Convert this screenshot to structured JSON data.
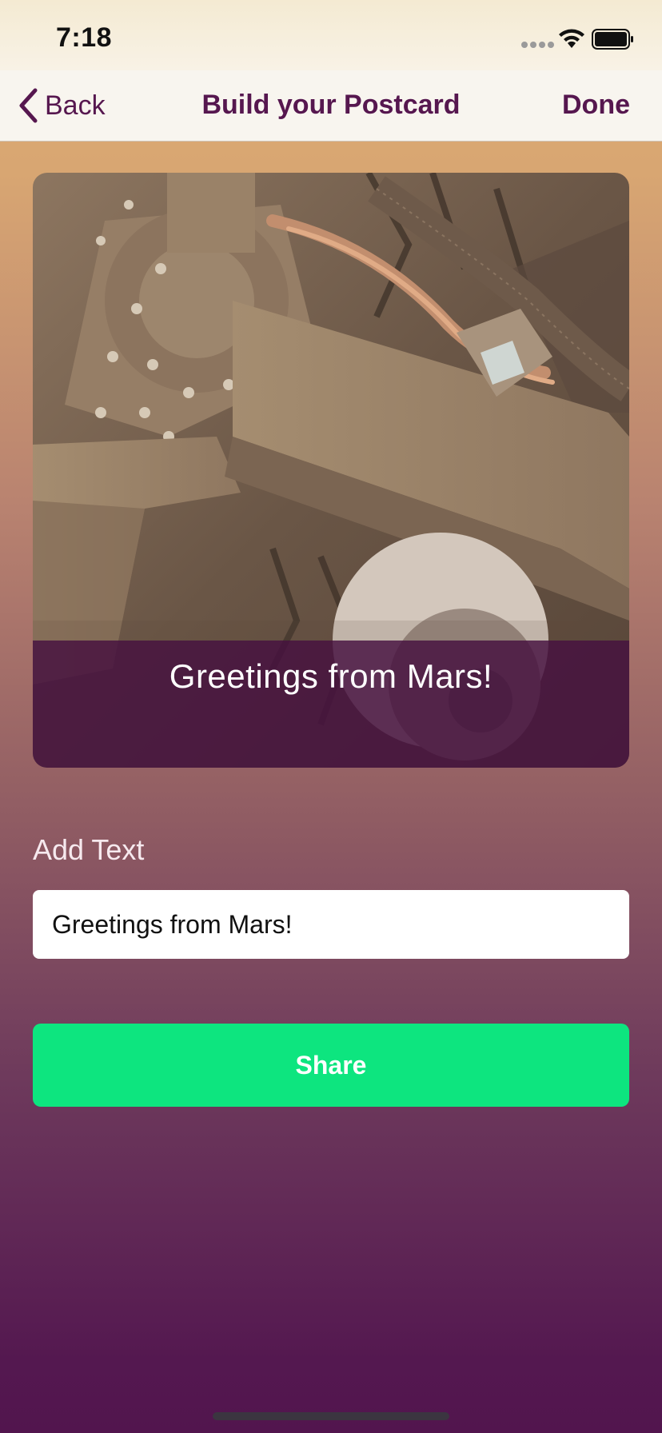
{
  "status_bar": {
    "time": "7:18",
    "icons": [
      "signal-icon",
      "wifi-icon",
      "battery-icon"
    ]
  },
  "nav": {
    "back_label": "Back",
    "title": "Build your Postcard",
    "done_label": "Done",
    "tint_color": "#56174f"
  },
  "postcard": {
    "caption": "Greetings from Mars!"
  },
  "form": {
    "add_text_label": "Add Text",
    "text_value": "Greetings from Mars!",
    "share_label": "Share",
    "share_color": "#0de57f"
  }
}
